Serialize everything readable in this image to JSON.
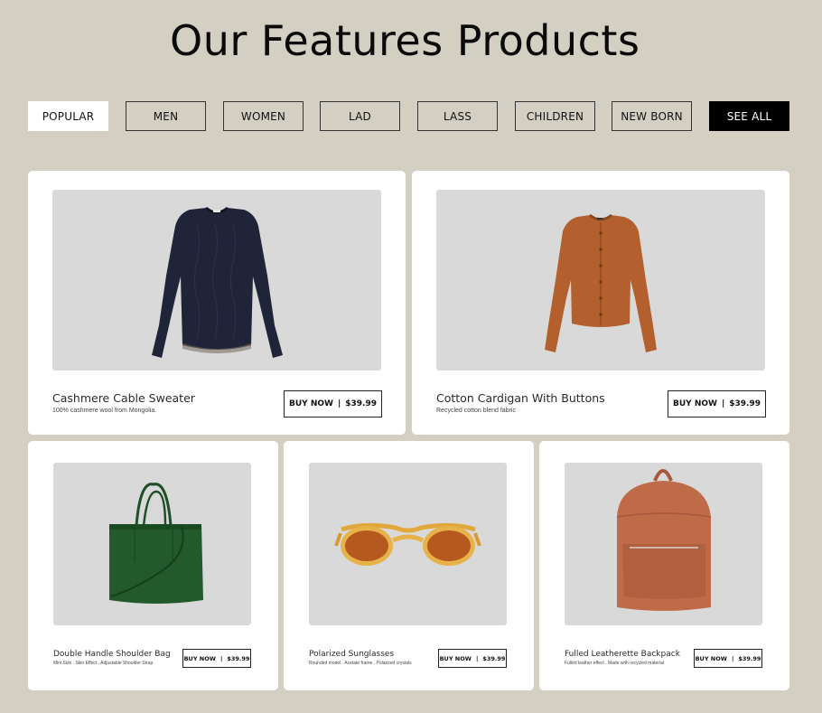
{
  "header": {
    "title": "Our Features Products"
  },
  "filters": [
    {
      "label": "POPULAR",
      "state": "active"
    },
    {
      "label": "MEN",
      "state": "outline"
    },
    {
      "label": "WOMEN",
      "state": "outline"
    },
    {
      "label": "LAD",
      "state": "outline"
    },
    {
      "label": "LASS",
      "state": "outline"
    },
    {
      "label": "CHILDREN",
      "state": "outline"
    },
    {
      "label": "NEW BORN",
      "state": "outline"
    },
    {
      "label": "SEE ALL",
      "state": "dark"
    }
  ],
  "buy_label": "BUY NOW",
  "buy_separator": "|",
  "products": [
    {
      "name": "Cashmere Cable Sweater",
      "description": "100% cashmere wool from Mongolia.",
      "price": "$39.99",
      "image": "navy-sweater-icon",
      "color": "#1f2438"
    },
    {
      "name": "Cotton Cardigan With Buttons",
      "description": "Recycled cotton blend fabric",
      "price": "$39.99",
      "image": "rust-cardigan-icon",
      "color": "#b3602e"
    },
    {
      "name": "Double Handle Shoulder Bag",
      "description": "Mini Size . Skin Effect . Adjustable Shoulder Strap",
      "price": "$39.99",
      "image": "green-tote-bag-icon",
      "color": "#225a2c"
    },
    {
      "name": "Polarized Sunglasses",
      "description": "Rounded model . Acetate frame . Polarized crystals",
      "price": "$39.99",
      "image": "sunglasses-icon",
      "color": "#e8b24a"
    },
    {
      "name": "Fulled Leatherette Backpack",
      "description": "Fulled leather effect . Made with recycled material",
      "price": "$39.99",
      "image": "backpack-icon",
      "color": "#bf6b48"
    }
  ]
}
